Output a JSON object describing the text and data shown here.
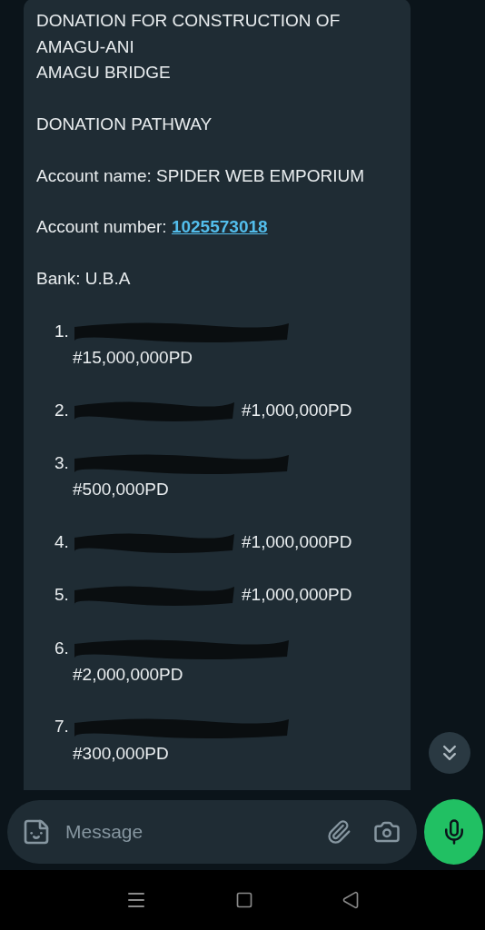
{
  "message": {
    "heading_lines": [
      "DONATION FOR CONSTRUCTION OF",
      "AMAGU-ANI",
      "AMAGU BRIDGE"
    ],
    "subheading": "DONATION PATHWAY",
    "fields": [
      {
        "label": "Account name:",
        "value": "SPIDER WEB EMPORIUM",
        "kind": "text"
      },
      {
        "label": "Account number:",
        "value": "1025573018",
        "kind": "link"
      },
      {
        "label": "Bank:",
        "value": "U.B.A",
        "kind": "text"
      }
    ],
    "donors": [
      {
        "number": "1.",
        "amount": "#15,000,000PD",
        "kind": "stacked"
      },
      {
        "number": "2.",
        "amount": "#1,000,000PD",
        "kind": "inline"
      },
      {
        "number": "3.",
        "amount": "#500,000PD",
        "kind": "stacked"
      },
      {
        "number": "4.",
        "amount": "#1,000,000PD",
        "kind": "inline"
      },
      {
        "number": "5.",
        "amount": "#1,000,000PD",
        "kind": "inline"
      },
      {
        "number": "6.",
        "amount": "#2,000,000PD",
        "kind": "stacked"
      },
      {
        "number": "7.",
        "amount": "#300,000PD",
        "kind": "stacked"
      }
    ]
  },
  "composer": {
    "placeholder": "Message"
  }
}
